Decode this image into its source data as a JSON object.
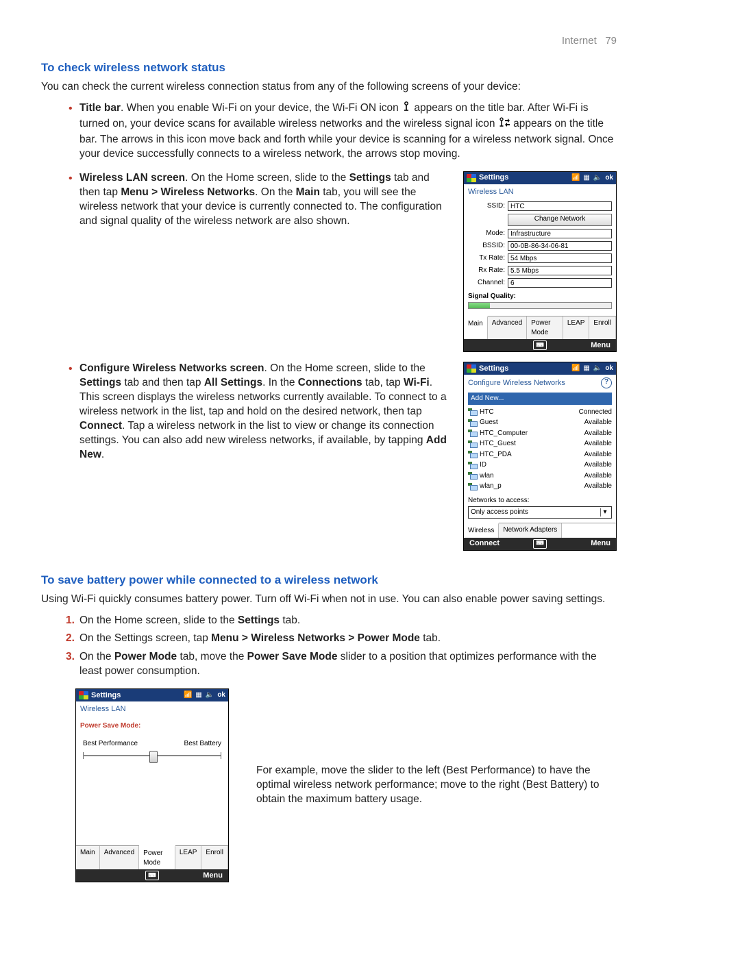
{
  "header": {
    "section": "Internet",
    "page": "79"
  },
  "h1": "To check wireless network status",
  "intro": "You can check the current wireless connection status from any of the following screens of your device:",
  "bullets": {
    "b1_lead": "Title bar",
    "b1_text_a": ". When you enable Wi-Fi on your device, the Wi-Fi ON icon ",
    "b1_text_b": " appears on the title bar. After Wi-Fi is turned on, your device scans for available wireless networks and the wireless signal icon ",
    "b1_text_c": " appears on the title bar. The arrows in this icon move back and forth while your device is scanning for a wireless network signal. Once your device successfully connects to a wireless network, the arrows stop moving.",
    "b2_lead": "Wireless LAN screen",
    "b2_text_a": ". On the Home screen, slide to the ",
    "b2_bold_settings": "Settings",
    "b2_text_b": " tab and then tap ",
    "b2_bold_path": "Menu > Wireless Networks",
    "b2_text_c": ". On the ",
    "b2_bold_main": "Main",
    "b2_text_d": " tab, you will see the wireless network that your device is currently connected to. The configuration and signal quality of the wireless network are also shown.",
    "b3_lead": "Configure Wireless Networks screen",
    "b3_text_a": ". On the Home screen, slide to the ",
    "b3_bold_settings": "Settings",
    "b3_text_b": " tab and then tap ",
    "b3_bold_all": "All Settings",
    "b3_text_c": ". In the ",
    "b3_bold_conn": "Connections",
    "b3_text_d": " tab, tap ",
    "b3_bold_wifi": "Wi-Fi",
    "b3_text_e": ". This screen displays the wireless networks currently available. To connect to a wireless network in the list, tap and hold on the desired network, then tap ",
    "b3_bold_connect": "Connect",
    "b3_text_f": ". Tap a wireless network in the list to view or change its connection settings. You can also add new wireless networks, if available, by tapping ",
    "b3_bold_addnew": "Add New",
    "b3_text_g": "."
  },
  "h2": "To save battery power while connected to a wireless network",
  "battery_intro": "Using Wi-Fi quickly consumes battery power. Turn off Wi-Fi when not in use. You can also enable power saving settings.",
  "steps": {
    "s1_a": "On the Home screen, slide to the ",
    "s1_b": "Settings",
    "s1_c": " tab.",
    "s2_a": "On the Settings screen, tap ",
    "s2_b": "Menu > Wireless Networks > Power Mode",
    "s2_c": " tab.",
    "s3_a": "On the ",
    "s3_b": "Power Mode",
    "s3_c": " tab, move the ",
    "s3_d": "Power Save Mode",
    "s3_e": " slider to a position that optimizes performance with the least power consumption."
  },
  "example_text": "For example, move the slider to the left (Best Performance) to have the optimal wireless network performance; move to the right (Best Battery) to obtain the maximum battery usage.",
  "wm_common": {
    "title": "Settings",
    "ok": "ok",
    "menu": "Menu"
  },
  "wlan_shot": {
    "subheader": "Wireless LAN",
    "rows": {
      "ssid_label": "SSID:",
      "ssid": "HTC",
      "change_btn": "Change Network",
      "mode_label": "Mode:",
      "mode": "Infrastructure",
      "bssid_label": "BSSID:",
      "bssid": "00-0B-86-34-06-81",
      "tx_label": "Tx Rate:",
      "tx": "54 Mbps",
      "rx_label": "Rx Rate:",
      "rx": "5.5 Mbps",
      "channel_label": "Channel:",
      "channel": "6",
      "sig_label": "Signal Quality:"
    },
    "tabs": [
      "Main",
      "Advanced",
      "Power Mode",
      "LEAP",
      "Enroll"
    ]
  },
  "cfg_shot": {
    "subheader": "Configure Wireless Networks",
    "add_new": "Add New...",
    "networks": [
      {
        "name": "HTC",
        "status": "Connected"
      },
      {
        "name": "Guest",
        "status": "Available"
      },
      {
        "name": "HTC_Computer",
        "status": "Available"
      },
      {
        "name": "HTC_Guest",
        "status": "Available"
      },
      {
        "name": "HTC_PDA",
        "status": "Available"
      },
      {
        "name": "ID",
        "status": "Available"
      },
      {
        "name": "wlan",
        "status": "Available"
      },
      {
        "name": "wlan_p",
        "status": "Available"
      }
    ],
    "access_label": "Networks to access:",
    "access_value": "Only access points",
    "tabs": [
      "Wireless",
      "Network Adapters"
    ],
    "footer_left": "Connect"
  },
  "power_shot": {
    "subheader": "Wireless LAN",
    "mode_title": "Power Save Mode:",
    "left_label": "Best Performance",
    "right_label": "Best Battery",
    "tabs": [
      "Main",
      "Advanced",
      "Power Mode",
      "LEAP",
      "Enroll"
    ]
  }
}
